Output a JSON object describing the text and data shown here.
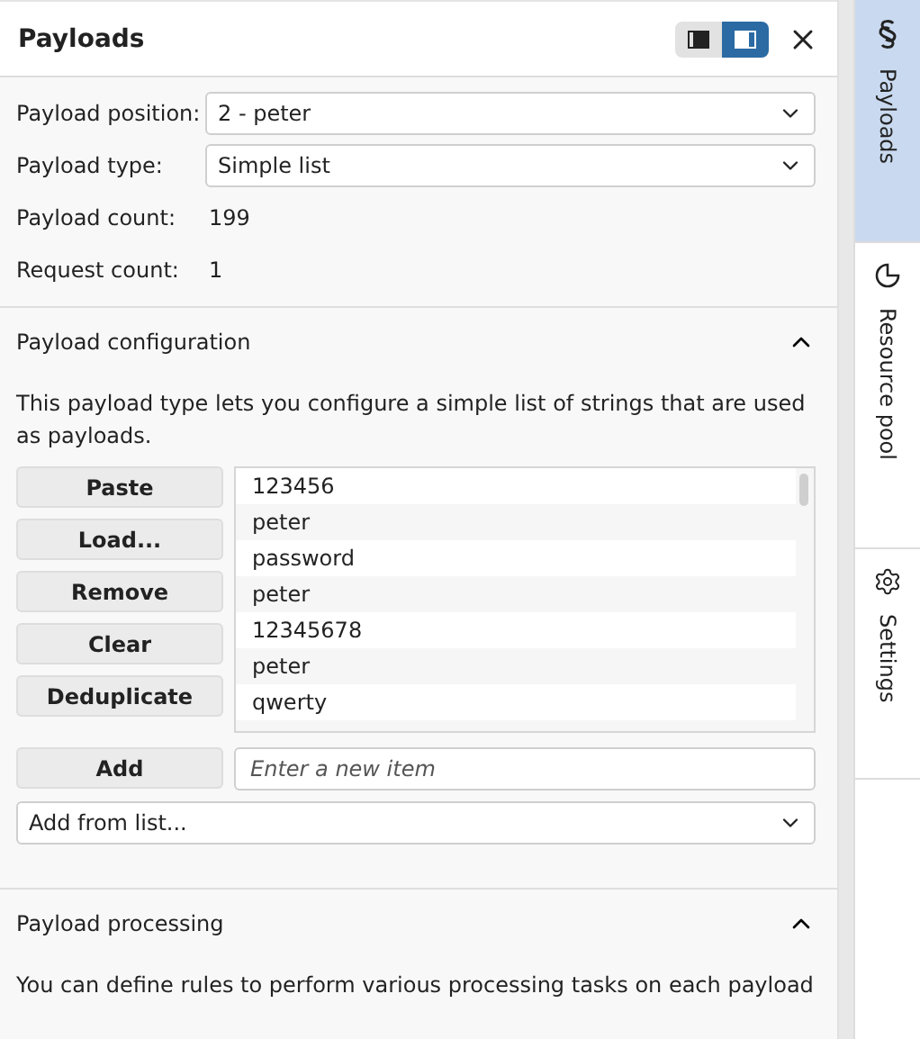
{
  "header": {
    "title": "Payloads",
    "layout_buttons": [
      {
        "kind": "left",
        "selected": false
      },
      {
        "kind": "right",
        "selected": true
      }
    ]
  },
  "fields": [
    {
      "kind": "select",
      "label": "Payload position:",
      "value": "2 - peter"
    },
    {
      "kind": "select",
      "label": "Payload type:",
      "value": "Simple list"
    },
    {
      "kind": "text",
      "label": "Payload count:",
      "value": "199"
    },
    {
      "kind": "text",
      "label": "Request count:",
      "value": "1"
    }
  ],
  "payload_configuration": {
    "title": "Payload configuration",
    "expanded": true,
    "description": "This payload type lets you configure a simple list of strings that are used as payloads.",
    "buttons": [
      "Paste",
      "Load...",
      "Remove",
      "Clear",
      "Deduplicate"
    ],
    "items": [
      "123456",
      "peter",
      "password",
      "peter",
      "12345678",
      "peter",
      "qwerty"
    ],
    "add_button": "Add",
    "add_placeholder": "Enter a new item",
    "add_from_list": "Add from list..."
  },
  "payload_processing": {
    "title": "Payload processing",
    "expanded": true,
    "description": "You can define rules to perform various processing tasks on each payload"
  },
  "side_tabs": [
    {
      "kind": "payloads",
      "label": "Payloads",
      "selected": true
    },
    {
      "kind": "resource",
      "label": "Resource pool",
      "selected": false
    },
    {
      "kind": "settings",
      "label": "Settings",
      "selected": false
    }
  ]
}
